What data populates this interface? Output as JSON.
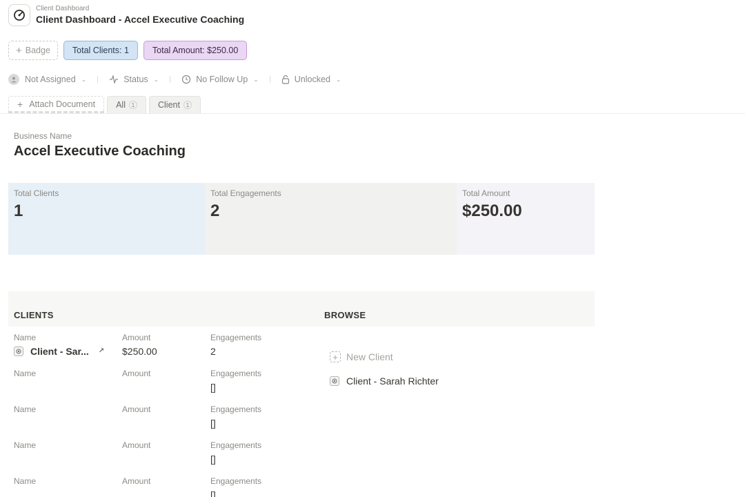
{
  "header": {
    "breadcrumb": "Client Dashboard",
    "title": "Client Dashboard - Accel Executive Coaching"
  },
  "badges": {
    "add_label": "Badge",
    "total_clients": "Total Clients: 1",
    "total_amount": "Total Amount: $250.00"
  },
  "properties": {
    "assignee": "Not Assigned",
    "status": "Status",
    "follow_up": "No Follow Up",
    "lock": "Unlocked"
  },
  "tabs": {
    "attach": "Attach Document",
    "items": [
      {
        "label": "All",
        "count": "1"
      },
      {
        "label": "Client",
        "count": "1"
      }
    ]
  },
  "business": {
    "label": "Business Name",
    "name": "Accel Executive Coaching"
  },
  "stats": [
    {
      "label": "Total Clients",
      "value": "1"
    },
    {
      "label": "Total Engagements",
      "value": "2"
    },
    {
      "label": "Total Amount",
      "value": "$250.00"
    }
  ],
  "clients": {
    "title": "CLIENTS",
    "columns": {
      "name": "Name",
      "amount": "Amount",
      "engagements": "Engagements"
    },
    "rows": [
      {
        "name": "Client - Sar...",
        "amount": "$250.00",
        "engagements": "2"
      },
      {
        "name": "",
        "amount": "",
        "engagements": "[]"
      },
      {
        "name": "",
        "amount": "",
        "engagements": "[]"
      },
      {
        "name": "",
        "amount": "",
        "engagements": "[]"
      },
      {
        "name": "",
        "amount": "",
        "engagements": "[]"
      }
    ]
  },
  "browse": {
    "title": "BROWSE",
    "new_client": "New Client",
    "client": "Client - Sarah Richter"
  },
  "colors": {
    "blue_badge": "#d3e4f4",
    "purple_badge": "#ead7f3",
    "stat_blue": "#e7eff7",
    "stat_gray": "#f1f1ef",
    "stat_lavender": "#f4f3f7"
  }
}
